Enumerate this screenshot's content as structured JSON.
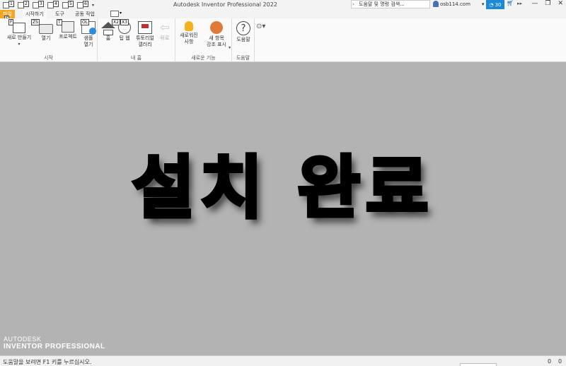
{
  "title_bar": {
    "app_title": "Autodesk Inventor Professional 2022",
    "quick_access_keytips": [
      "1",
      "2",
      "3",
      "4",
      "5",
      "6"
    ],
    "search_placeholder": "도움말 및 명령 검색...",
    "user": "osb114.com",
    "trial_days": "30"
  },
  "tabs": [
    {
      "label": "파일",
      "keytip": "F"
    },
    {
      "label": "시작하기",
      "keytip": ""
    },
    {
      "label": "도구",
      "keytip": ""
    },
    {
      "label": "공동 작업",
      "keytip": ""
    }
  ],
  "ribbon": {
    "groups": {
      "start": {
        "label": "시작",
        "buttons": {
          "new": {
            "label": "새로 만들기",
            "keytip": "F"
          },
          "open": {
            "label": "열기",
            "keytip": "ZS"
          },
          "projects": {
            "label": "프로젝트",
            "keytip": "T"
          },
          "open_samples": {
            "label1": "샘플",
            "label2": "열기",
            "keytip": "OL"
          }
        }
      },
      "my_home": {
        "label": "내 홈",
        "buttons": {
          "home": {
            "label": "홈",
            "keytip": "X2"
          },
          "tip_web": {
            "label": "팁 웹",
            "keytip": "X3"
          },
          "tutorial_gallery": {
            "label1": "튜토리얼",
            "label2": "갤러리"
          },
          "back": {
            "label": "뒤로"
          }
        }
      },
      "new_features": {
        "label": "새로운 기능",
        "buttons": {
          "whats_new": {
            "label1": "새로워진",
            "label2": "사항"
          },
          "highlight_new": {
            "label1": "새 항목",
            "label2": "강조 표시"
          }
        }
      },
      "help": {
        "label": "도움말",
        "buttons": {
          "help": {
            "label": "도움말"
          }
        }
      }
    }
  },
  "canvas": {
    "overlay_text": "설치 완료",
    "brand_line1": "AUTODESK",
    "brand_line2": "INVENTOR PROFESSIONAL"
  },
  "status_bar": {
    "text": "도움말을 보려면 F1 키를 누르십시오.",
    "count1": "0",
    "count2": "0"
  },
  "colors": {
    "file_tab": "#f5a623",
    "trial_badge": "#1b89d6",
    "canvas_bg": "#b3b3b3",
    "overlay_text": "#ff0000"
  }
}
